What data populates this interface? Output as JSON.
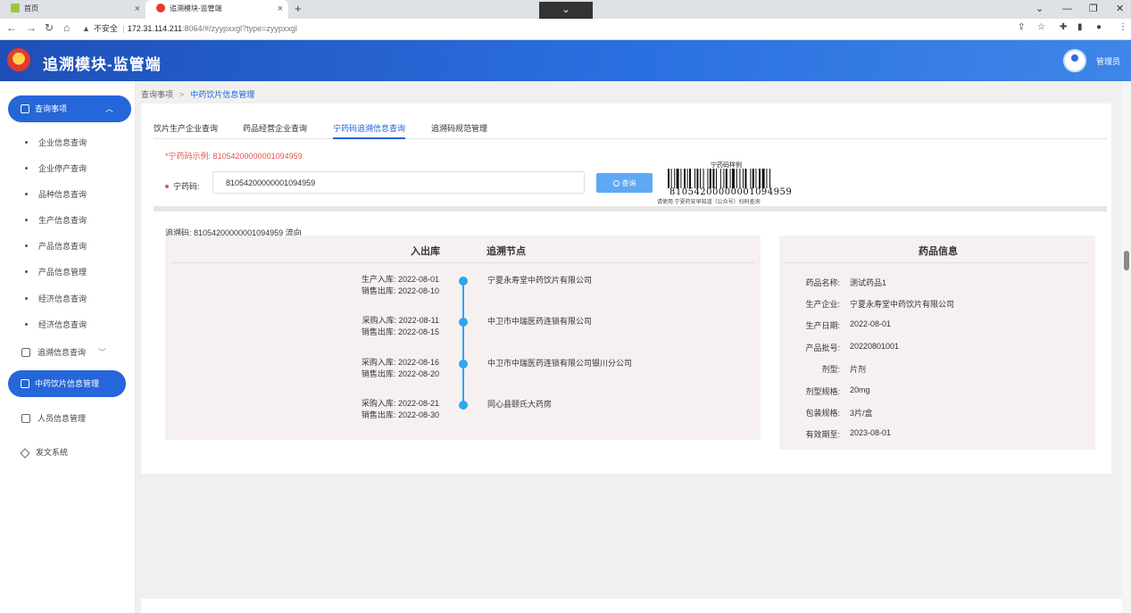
{
  "browser": {
    "tabs": [
      {
        "title": "首页",
        "active": false
      },
      {
        "title": "追溯模块-监管端",
        "active": true
      }
    ],
    "security_label": "不安全",
    "host": "172.31.114.211",
    "path": ":8064/#/zyypxxgl?type=zyypxxgl"
  },
  "app": {
    "title": "追溯模块-监管端",
    "user": "管理员"
  },
  "sidebar": {
    "group_query": "查询事项",
    "query_items": [
      "企业信息查询",
      "企业停产查询",
      "品种信息查询",
      "生产信息查询",
      "产品信息查询",
      "产品信息管理",
      "经济信息查询",
      "经济信息查询"
    ],
    "trace_query": "追溯信息查询",
    "active_item": "中药饮片信息管理",
    "personnel": "人员信息管理",
    "publish": "发文系统"
  },
  "breadcrumb": {
    "root": "查询事项",
    "current": "中药饮片信息管理"
  },
  "tabs": [
    "饮片生产企业查询",
    "药品经营企业查询",
    "宁药码追溯信息查询",
    "追溯码规范管理"
  ],
  "search": {
    "hint": "*宁药码示例: 81054200000001094959",
    "label": "宁药码:",
    "value": "81054200000001094959",
    "button": "查询"
  },
  "barcode": {
    "title": "宁药码样例",
    "number": "81054200000001094959",
    "note": "请使用 宁夏药安早知道（公众号）扫码查询"
  },
  "trace": {
    "title": "追溯码: 81054200000001094959 流向",
    "col_inout": "入出库",
    "col_node": "追溯节点",
    "rows": [
      {
        "in_label": "生产入库:",
        "in_date": "2022-08-01",
        "out_label": "销售出库:",
        "out_date": "2022-08-10",
        "node": "宁夏永寿堂中药饮片有限公司"
      },
      {
        "in_label": "采购入库:",
        "in_date": "2022-08-11",
        "out_label": "销售出库:",
        "out_date": "2022-08-15",
        "node": "中卫市中瑞医药连锁有限公司"
      },
      {
        "in_label": "采购入库:",
        "in_date": "2022-08-16",
        "out_label": "销售出库:",
        "out_date": "2022-08-20",
        "node": "中卫市中瑞医药连锁有限公司银川分公司"
      },
      {
        "in_label": "采购入库:",
        "in_date": "2022-08-21",
        "out_label": "销售出库:",
        "out_date": "2022-08-30",
        "node": "同心县颐氏大药房"
      }
    ]
  },
  "drug": {
    "title": "药品信息",
    "fields": [
      {
        "label": "药品名称:",
        "value": "测试药品1"
      },
      {
        "label": "生产企业:",
        "value": "宁夏永寿堂中药饮片有限公司"
      },
      {
        "label": "生产日期:",
        "value": "2022-08-01"
      },
      {
        "label": "产品批号:",
        "value": "20220801001"
      },
      {
        "label": "剂型:",
        "value": "片剂"
      },
      {
        "label": "剂型规格:",
        "value": "20mg"
      },
      {
        "label": "包装规格:",
        "value": "3片/盒"
      },
      {
        "label": "有效期至:",
        "value": "2023-08-01"
      }
    ]
  },
  "colors": {
    "primary": "#2566d9",
    "link": "#1a64d8",
    "timeline": "#2aa7f0",
    "hint": "#e0574e",
    "button": "#5ea9f5"
  }
}
